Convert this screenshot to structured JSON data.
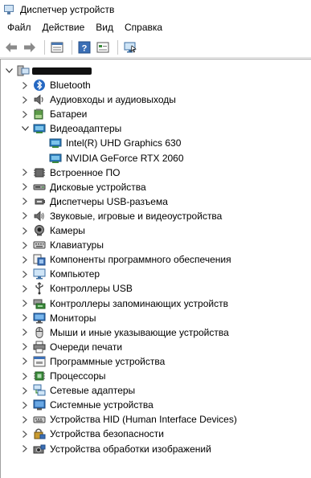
{
  "window": {
    "title": "Диспетчер устройств"
  },
  "menu": [
    "Файл",
    "Действие",
    "Вид",
    "Справка"
  ],
  "tree": {
    "root_label": "",
    "items": [
      {
        "label": "Bluetooth",
        "icon": "bluetooth-icon",
        "expanded": false
      },
      {
        "label": "Аудиовходы и аудиовыходы",
        "icon": "speaker-icon",
        "expanded": false
      },
      {
        "label": "Батареи",
        "icon": "battery-icon",
        "expanded": false
      },
      {
        "label": "Видеоадаптеры",
        "icon": "display-adapter-icon",
        "expanded": true,
        "children": [
          {
            "label": "Intel(R) UHD Graphics 630",
            "icon": "display-adapter-icon"
          },
          {
            "label": "NVIDIA GeForce RTX 2060",
            "icon": "display-adapter-icon"
          }
        ]
      },
      {
        "label": "Встроенное ПО",
        "icon": "firmware-icon",
        "expanded": false
      },
      {
        "label": "Дисковые устройства",
        "icon": "disk-drive-icon",
        "expanded": false
      },
      {
        "label": "Диспетчеры USB-разъема",
        "icon": "usb-connector-icon",
        "expanded": false
      },
      {
        "label": "Звуковые, игровые и видеоустройства",
        "icon": "sound-icon",
        "expanded": false
      },
      {
        "label": "Камеры",
        "icon": "camera-icon",
        "expanded": false
      },
      {
        "label": "Клавиатуры",
        "icon": "keyboard-icon",
        "expanded": false
      },
      {
        "label": "Компоненты программного обеспечения",
        "icon": "software-component-icon",
        "expanded": false
      },
      {
        "label": "Компьютер",
        "icon": "computer-icon",
        "expanded": false
      },
      {
        "label": "Контроллеры USB",
        "icon": "usb-controller-icon",
        "expanded": false
      },
      {
        "label": "Контроллеры запоминающих устройств",
        "icon": "storage-controller-icon",
        "expanded": false
      },
      {
        "label": "Мониторы",
        "icon": "monitor-icon",
        "expanded": false
      },
      {
        "label": "Мыши и иные указывающие устройства",
        "icon": "mouse-icon",
        "expanded": false
      },
      {
        "label": "Очереди печати",
        "icon": "printer-icon",
        "expanded": false
      },
      {
        "label": "Программные устройства",
        "icon": "software-device-icon",
        "expanded": false
      },
      {
        "label": "Процессоры",
        "icon": "processor-icon",
        "expanded": false
      },
      {
        "label": "Сетевые адаптеры",
        "icon": "network-adapter-icon",
        "expanded": false
      },
      {
        "label": "Системные устройства",
        "icon": "system-device-icon",
        "expanded": false
      },
      {
        "label": "Устройства HID (Human Interface Devices)",
        "icon": "hid-icon",
        "expanded": false
      },
      {
        "label": "Устройства безопасности",
        "icon": "security-device-icon",
        "expanded": false
      },
      {
        "label": "Устройства обработки изображений",
        "icon": "imaging-device-icon",
        "expanded": false
      }
    ]
  },
  "colors": {
    "blue_icon": "#2d6db5",
    "green_icon": "#3a8a3a",
    "gray_icon": "#6b6b6b"
  }
}
